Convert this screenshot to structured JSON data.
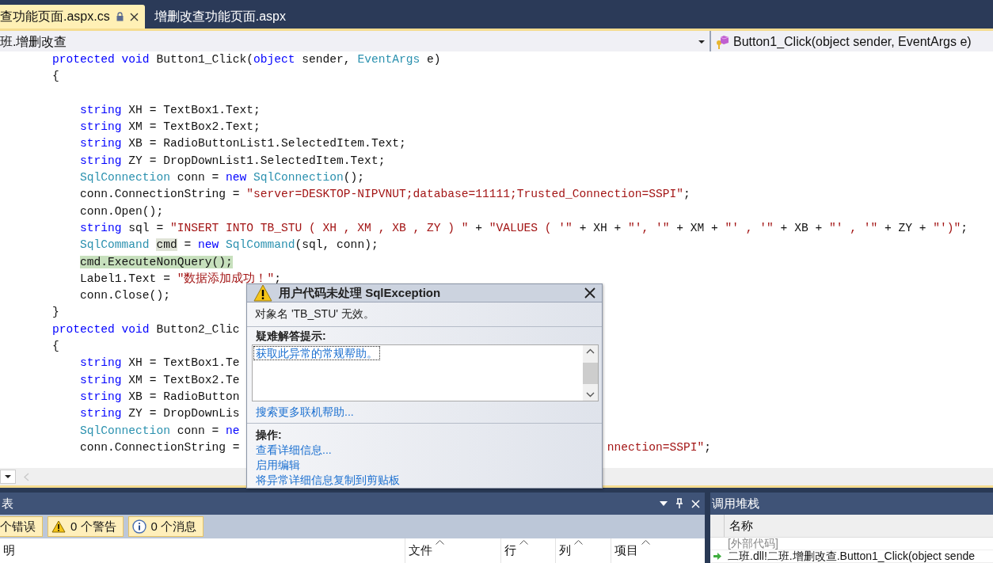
{
  "tabs": [
    {
      "label": "查功能页面.aspx.cs",
      "selected": true,
      "locked": true
    },
    {
      "label": "增删改查功能页面.aspx",
      "selected": false,
      "locked": false
    }
  ],
  "nav": {
    "class_dropdown": "班.增删改查",
    "member_dropdown": "Button1_Click(object sender, EventArgs e)"
  },
  "code": {
    "methods": [
      {
        "signature": [
          {
            "kind": "kw",
            "text": "protected "
          },
          {
            "kind": "kw",
            "text": "void "
          },
          {
            "text": "Button1_Click("
          },
          {
            "kind": "kw",
            "text": "object "
          },
          {
            "text": "sender, "
          },
          {
            "kind": "type",
            "text": "EventArgs "
          },
          {
            "text": "e)"
          }
        ],
        "open_brace": "{",
        "blank_line": true,
        "body": [
          {
            "tokens": [
              {
                "kind": "kw",
                "text": "string "
              },
              {
                "text": "XH = TextBox1.Text;"
              }
            ]
          },
          {
            "tokens": [
              {
                "kind": "kw",
                "text": "string "
              },
              {
                "text": "XM = TextBox2.Text;"
              }
            ]
          },
          {
            "tokens": [
              {
                "kind": "kw",
                "text": "string "
              },
              {
                "text": "XB = RadioButtonList1.SelectedItem.Text;"
              }
            ]
          },
          {
            "tokens": [
              {
                "kind": "kw",
                "text": "string "
              },
              {
                "text": "ZY = DropDownList1.SelectedItem.Text;"
              }
            ]
          },
          {
            "tokens": [
              {
                "kind": "type",
                "text": "SqlConnection "
              },
              {
                "text": "conn = "
              },
              {
                "kind": "kw",
                "text": "new "
              },
              {
                "kind": "type",
                "text": "SqlConnection"
              },
              {
                "text": "();"
              }
            ]
          },
          {
            "tokens": [
              {
                "text": "conn.ConnectionString = "
              },
              {
                "kind": "str",
                "text": "\"server=DESKTOP-NIPVNUT;database=11111;Trusted_Connection=SSPI\""
              },
              {
                "text": ";"
              }
            ]
          },
          {
            "tokens": [
              {
                "text": "conn.Open();"
              }
            ]
          },
          {
            "tokens": [
              {
                "kind": "kw",
                "text": "string "
              },
              {
                "text": "sql = "
              },
              {
                "kind": "str",
                "text": "\"INSERT INTO TB_STU ( XH , XM , XB , ZY ) \""
              },
              {
                "text": " + "
              },
              {
                "kind": "str",
                "text": "\"VALUES ( '\""
              },
              {
                "text": " + XH + "
              },
              {
                "kind": "str",
                "text": "\"', '\""
              },
              {
                "text": " + XM + "
              },
              {
                "kind": "str",
                "text": "\"' , '\""
              },
              {
                "text": " + XB + "
              },
              {
                "kind": "str",
                "text": "\"' , '\""
              },
              {
                "text": " + ZY + "
              },
              {
                "kind": "str",
                "text": "\"')\""
              },
              {
                "text": ";"
              }
            ]
          },
          {
            "tokens": [
              {
                "kind": "type",
                "text": "SqlCommand "
              },
              {
                "text": "cmd",
                "reference_highlight": true
              },
              {
                "text": " = "
              },
              {
                "kind": "kw",
                "text": "new "
              },
              {
                "kind": "type",
                "text": "SqlCommand"
              },
              {
                "text": "(sql, conn);"
              }
            ]
          },
          {
            "tokens": [
              {
                "text": "cmd.ExecuteNonQuery();",
                "current_statement": true
              }
            ]
          },
          {
            "tokens": [
              {
                "text": "Label1.Text = "
              },
              {
                "kind": "str",
                "text": "\"数据添加成功！\""
              },
              {
                "text": ";"
              }
            ]
          },
          {
            "tokens": [
              {
                "text": "conn.Close();"
              }
            ]
          }
        ],
        "close_brace": "}"
      },
      {
        "signature": [
          {
            "kind": "kw",
            "text": "protected "
          },
          {
            "kind": "kw",
            "text": "void "
          },
          {
            "text": "Button2_Clic"
          }
        ],
        "open_brace": "{",
        "blank_line": false,
        "body": [
          {
            "tokens": [
              {
                "kind": "kw",
                "text": "string "
              },
              {
                "text": "XH = TextBox1.Te"
              }
            ]
          },
          {
            "tokens": [
              {
                "kind": "kw",
                "text": "string "
              },
              {
                "text": "XM = TextBox2.Te"
              }
            ]
          },
          {
            "tokens": [
              {
                "kind": "kw",
                "text": "string "
              },
              {
                "text": "XB = RadioButton"
              }
            ]
          },
          {
            "tokens": [
              {
                "kind": "kw",
                "text": "string "
              },
              {
                "text": "ZY = DropDownLis"
              }
            ]
          },
          {
            "tokens": [
              {
                "kind": "type",
                "text": "SqlConnection "
              },
              {
                "text": "conn = "
              },
              {
                "kind": "kw",
                "text": "ne"
              }
            ]
          },
          {
            "tokens": [
              {
                "text": "conn.ConnectionString ="
              },
              {
                "kind": "str",
                "text": "nnection=SSPI\"",
                "after_hidden": true
              },
              {
                "text": ";"
              }
            ]
          }
        ]
      }
    ]
  },
  "exception_dialog": {
    "title": "用户代码未处理 SqlException",
    "message": "对象名 'TB_STU' 无效。",
    "tips_heading": "疑难解答提示:",
    "tips": [
      "获取此异常的常规帮助。"
    ],
    "search_link": "搜索更多联机帮助...",
    "actions_heading": "操作:",
    "actions": [
      "查看详细信息...",
      "启用编辑",
      "将异常详细信息复制到剪贴板"
    ]
  },
  "error_list": {
    "title": "表",
    "filters": [
      {
        "label": "个错误",
        "kind": "errors",
        "selected": true
      },
      {
        "label": "0 个警告",
        "kind": "warnings",
        "selected": true
      },
      {
        "label": "0 个消息",
        "kind": "messages",
        "selected": true
      }
    ],
    "columns": [
      {
        "label": "明",
        "sort_indicator": false
      },
      {
        "label": "文件",
        "sort_indicator": true
      },
      {
        "label": "行",
        "sort_indicator": true
      },
      {
        "label": "列",
        "sort_indicator": true
      },
      {
        "label": "项目",
        "sort_indicator": true
      }
    ]
  },
  "call_stack": {
    "title": "调用堆栈",
    "column": "名称",
    "rows": [
      {
        "text": "[外部代码]",
        "kind": "external"
      },
      {
        "text": "二班.dll!二班.增删改查.Button1_Click(object sende",
        "kind": "current"
      }
    ]
  }
}
